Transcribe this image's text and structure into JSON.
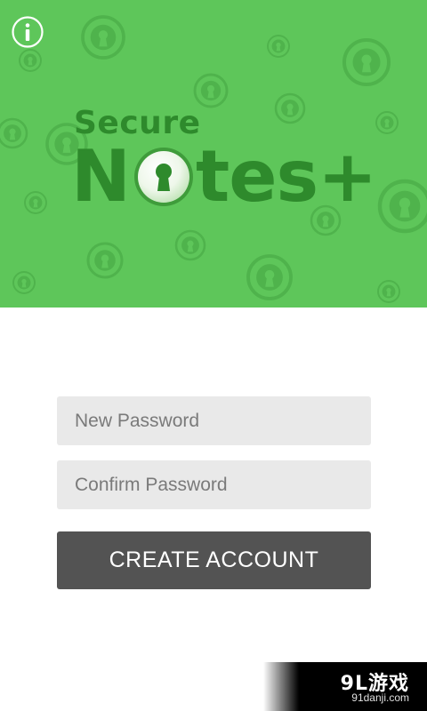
{
  "app": {
    "logo_line1": "Secure",
    "logo_line2_prefix": "N",
    "logo_line2_suffix": "tes+"
  },
  "header": {
    "info_icon": "info-icon"
  },
  "form": {
    "new_password_placeholder": "New Password",
    "confirm_password_placeholder": "Confirm Password",
    "create_account_label": "CREATE ACCOUNT"
  },
  "watermark": {
    "brand": "9L游戏",
    "url": "91danji.com"
  },
  "colors": {
    "header_background": "#5ec65a",
    "logo_text": "#2e8a2c",
    "field_background": "#e9e9e9",
    "button_background": "#535353",
    "button_text": "#ffffff"
  }
}
